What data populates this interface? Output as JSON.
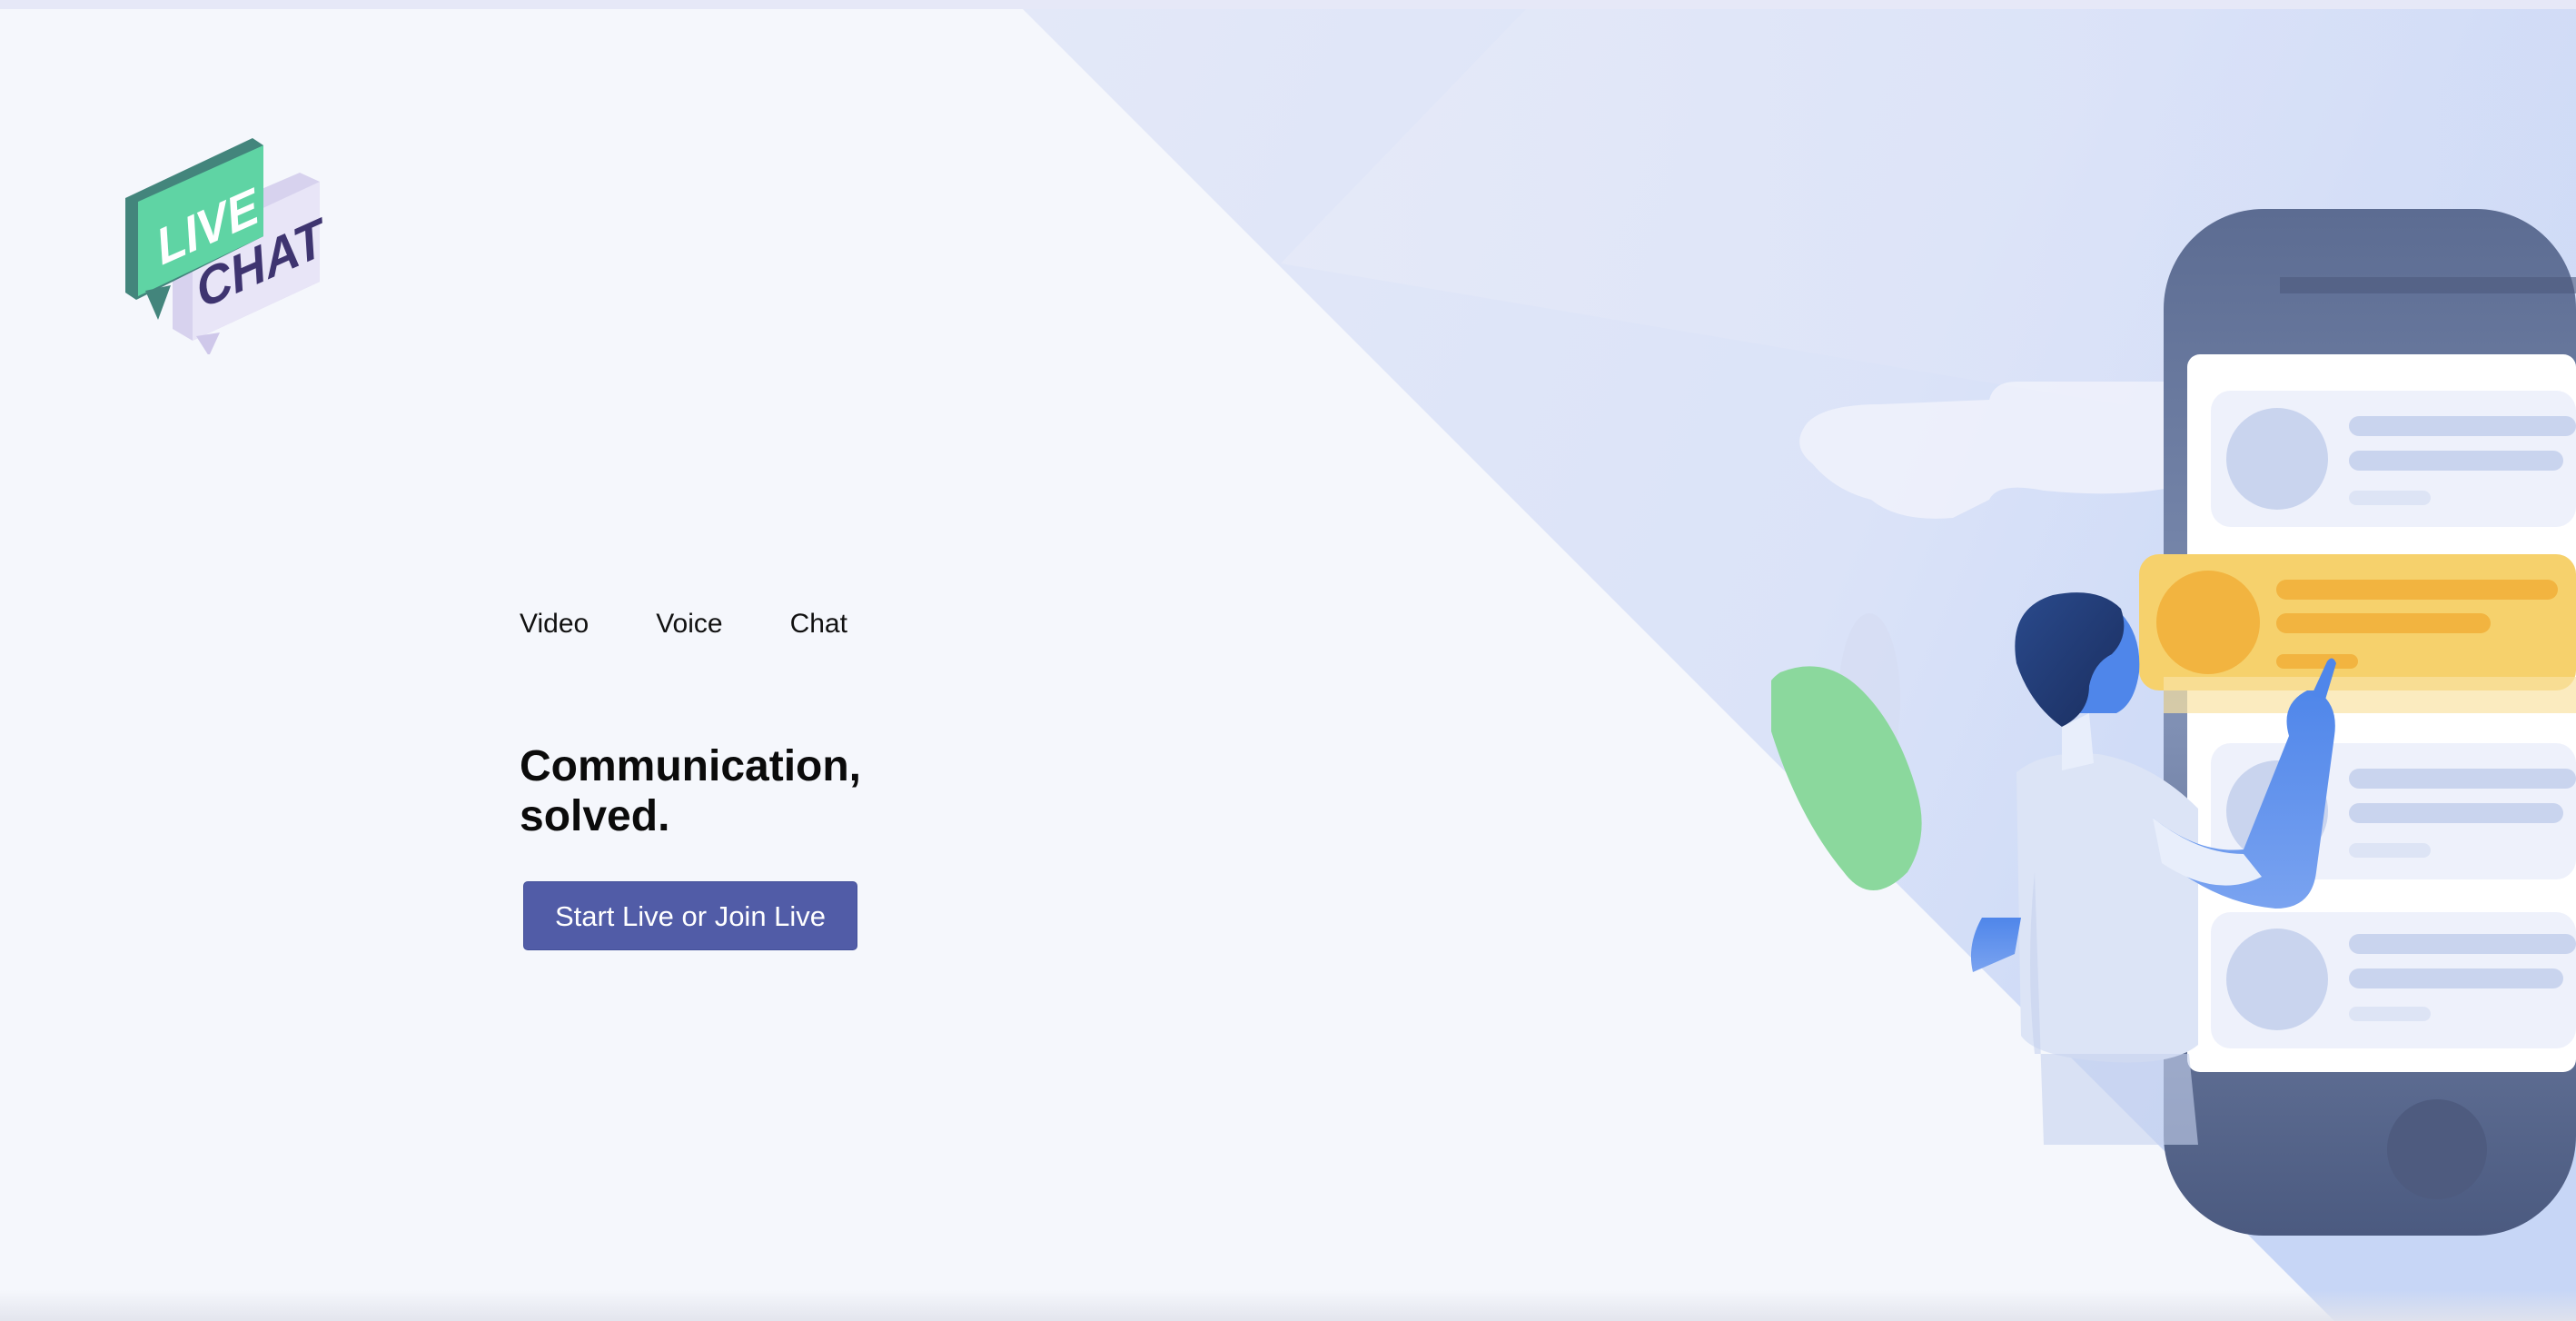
{
  "logo": {
    "word_top": "LIVE",
    "word_bottom": "CHAT",
    "icon": "live-chat-logo-icon"
  },
  "hero": {
    "tagline": [
      "Video",
      "Voice",
      "Chat"
    ],
    "headline_line1": "Communication,",
    "headline_line2": "solved.",
    "cta_label": "Start Live or Join Live"
  },
  "illustration": {
    "icon": "person-using-phone-illustration"
  },
  "colors": {
    "background": "#f5f7fc",
    "accent": "#515ca7",
    "logo_green": "#5fd4a4",
    "logo_purple": "#3e3470",
    "highlight_orange": "#f6c35a"
  }
}
